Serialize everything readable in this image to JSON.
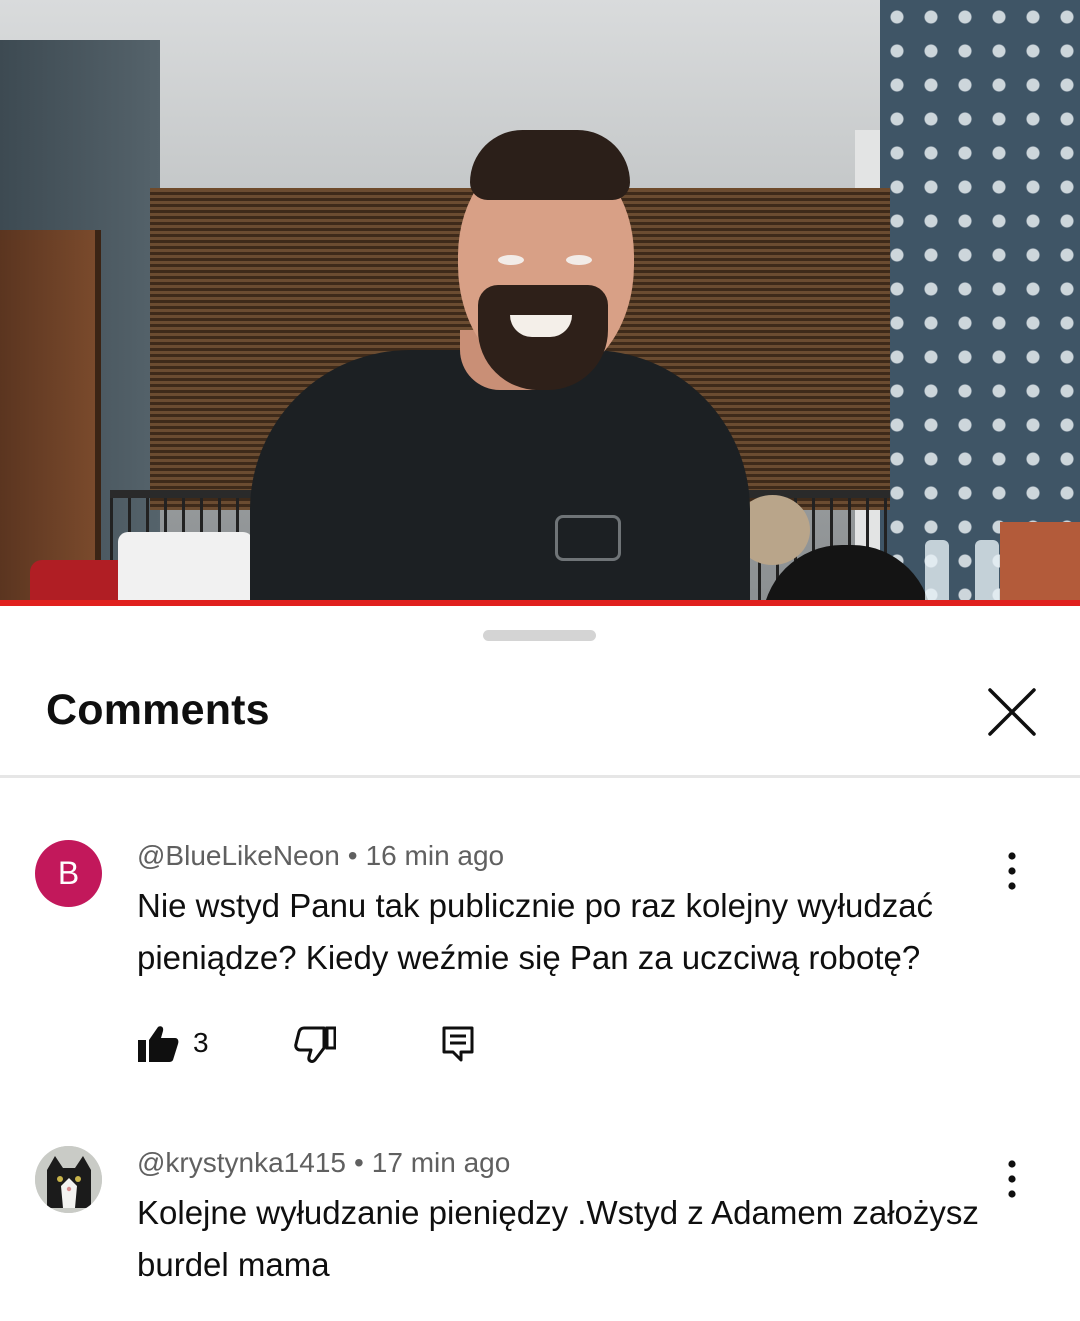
{
  "video": {
    "progress_fraction": 1.0
  },
  "panel": {
    "title": "Comments",
    "close_icon": "close-icon"
  },
  "comments": [
    {
      "avatar_letter": "B",
      "avatar_color": "#c2185b",
      "author": "@BlueLikeNeon",
      "separator": "•",
      "time": "16 min ago",
      "text": "Nie wstyd Panu tak publicznie po raz kolejny wyłudzać pieniądze? Kiedy weźmie się Pan za uczciwą robotę?",
      "like_count": "3",
      "icons": [
        "thumb-up-filled-icon",
        "thumb-down-icon",
        "reply-icon",
        "more-vert-icon"
      ]
    },
    {
      "avatar_letter": "",
      "author": "@krystynka1415",
      "separator": "•",
      "time": "17 min ago",
      "text": "Kolejne wyłudzanie pieniędzy .Wstyd z Adamem założysz burdel mama",
      "icons": [
        "more-vert-icon"
      ]
    }
  ],
  "colors": {
    "progress_red": "#e0201e",
    "secondary_text": "#606060",
    "primary_text": "#0f0f0f"
  }
}
